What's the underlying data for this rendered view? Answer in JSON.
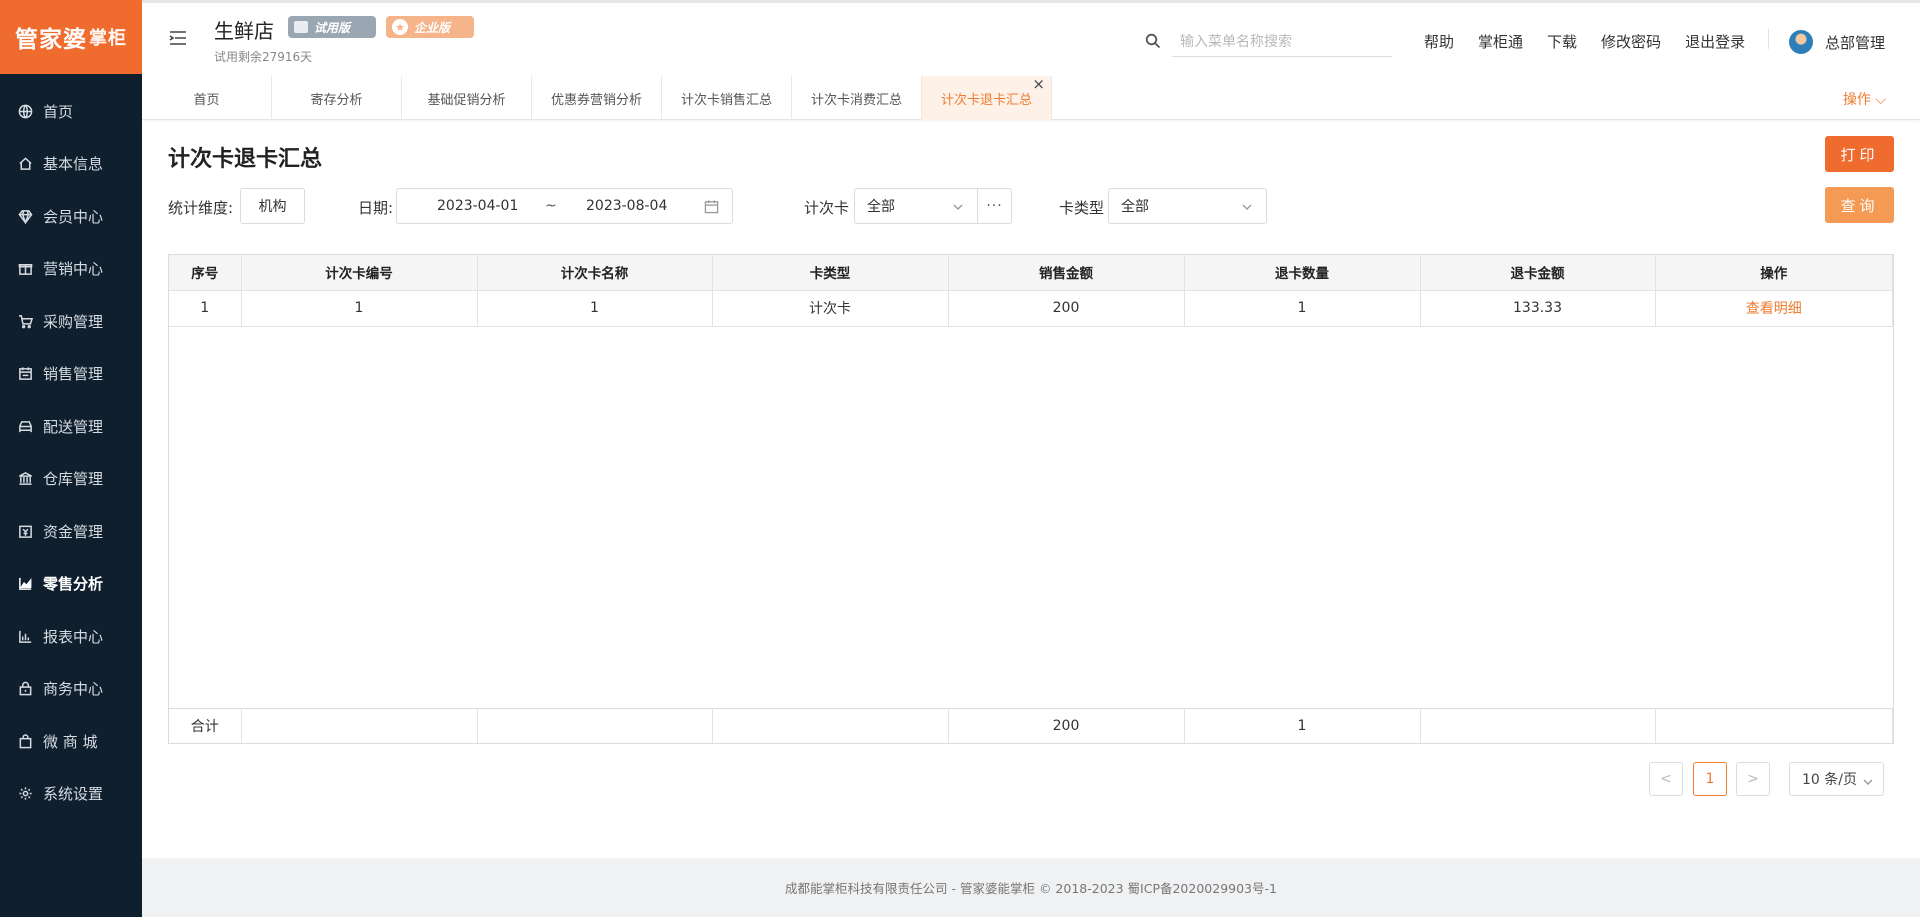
{
  "logo": {
    "main": "管家婆",
    "sub": "掌柜"
  },
  "sidebar": {
    "items": [
      {
        "label": "首页",
        "icon": "globe-icon"
      },
      {
        "label": "基本信息",
        "icon": "home-icon"
      },
      {
        "label": "会员中心",
        "icon": "diamond-icon"
      },
      {
        "label": "营销中心",
        "icon": "gift-icon"
      },
      {
        "label": "采购管理",
        "icon": "cart-icon"
      },
      {
        "label": "销售管理",
        "icon": "calendar-icon"
      },
      {
        "label": "配送管理",
        "icon": "car-icon"
      },
      {
        "label": "仓库管理",
        "icon": "bank-icon"
      },
      {
        "label": "资金管理",
        "icon": "money-icon"
      },
      {
        "label": "零售分析",
        "icon": "area-chart-icon",
        "active": true
      },
      {
        "label": "报表中心",
        "icon": "bar-chart-icon"
      },
      {
        "label": "商务中心",
        "icon": "lock-icon"
      },
      {
        "label": "微 商 城",
        "icon": "shop-icon"
      },
      {
        "label": "系统设置",
        "icon": "gear-icon"
      }
    ]
  },
  "header": {
    "store_name": "生鲜店",
    "badge_trial": "试用版",
    "badge_enterprise": "企业版",
    "trial_days": "试用剩余27916天",
    "search_placeholder": "输入菜单名称搜索",
    "links": [
      "帮助",
      "掌柜通",
      "下载",
      "修改密码",
      "退出登录"
    ],
    "user_name": "总部管理"
  },
  "tabs": {
    "items": [
      "首页",
      "寄存分析",
      "基础促销分析",
      "优惠券营销分析",
      "计次卡销售汇总",
      "计次卡消费汇总",
      "计次卡退卡汇总"
    ],
    "active_index": 6,
    "close": "×",
    "ops_label": "操作 ⌵"
  },
  "page": {
    "title": "计次卡退卡汇总",
    "print_label": "打印",
    "query_label": "查询"
  },
  "filters": {
    "dimension_label": "统计维度:",
    "dimension_value": "机构",
    "date_label": "日期:",
    "date_from": "2023-04-01",
    "date_sep": "~",
    "date_to": "2023-08-04",
    "card_label": "计次卡",
    "card_value": "全部",
    "more": "···",
    "type_label": "卡类型",
    "type_value": "全部"
  },
  "table": {
    "columns": [
      "序号",
      "计次卡编号",
      "计次卡名称",
      "卡类型",
      "销售金额",
      "退卡数量",
      "退卡金额",
      "操作"
    ],
    "rows": [
      {
        "no": "1",
        "code": "1",
        "name": "1",
        "type": "计次卡",
        "sales": "200",
        "qty": "1",
        "refund": "133.33",
        "action": "查看明细"
      }
    ],
    "footer": {
      "label": "合计",
      "code": "",
      "name": "",
      "type": "",
      "sales": "200",
      "qty": "1",
      "refund": "",
      "action": ""
    }
  },
  "pagination": {
    "prev": "<",
    "current": "1",
    "next": ">",
    "page_size": "10 条/页"
  },
  "footer": {
    "text": "成都能掌柜科技有限责任公司 - 管家婆能掌柜 © 2018-2023 蜀ICP备2020029903号-1"
  },
  "colors": {
    "accent": "#ef6b2e",
    "sidebar_bg": "#0f1f2e",
    "link": "#ef7b31"
  }
}
